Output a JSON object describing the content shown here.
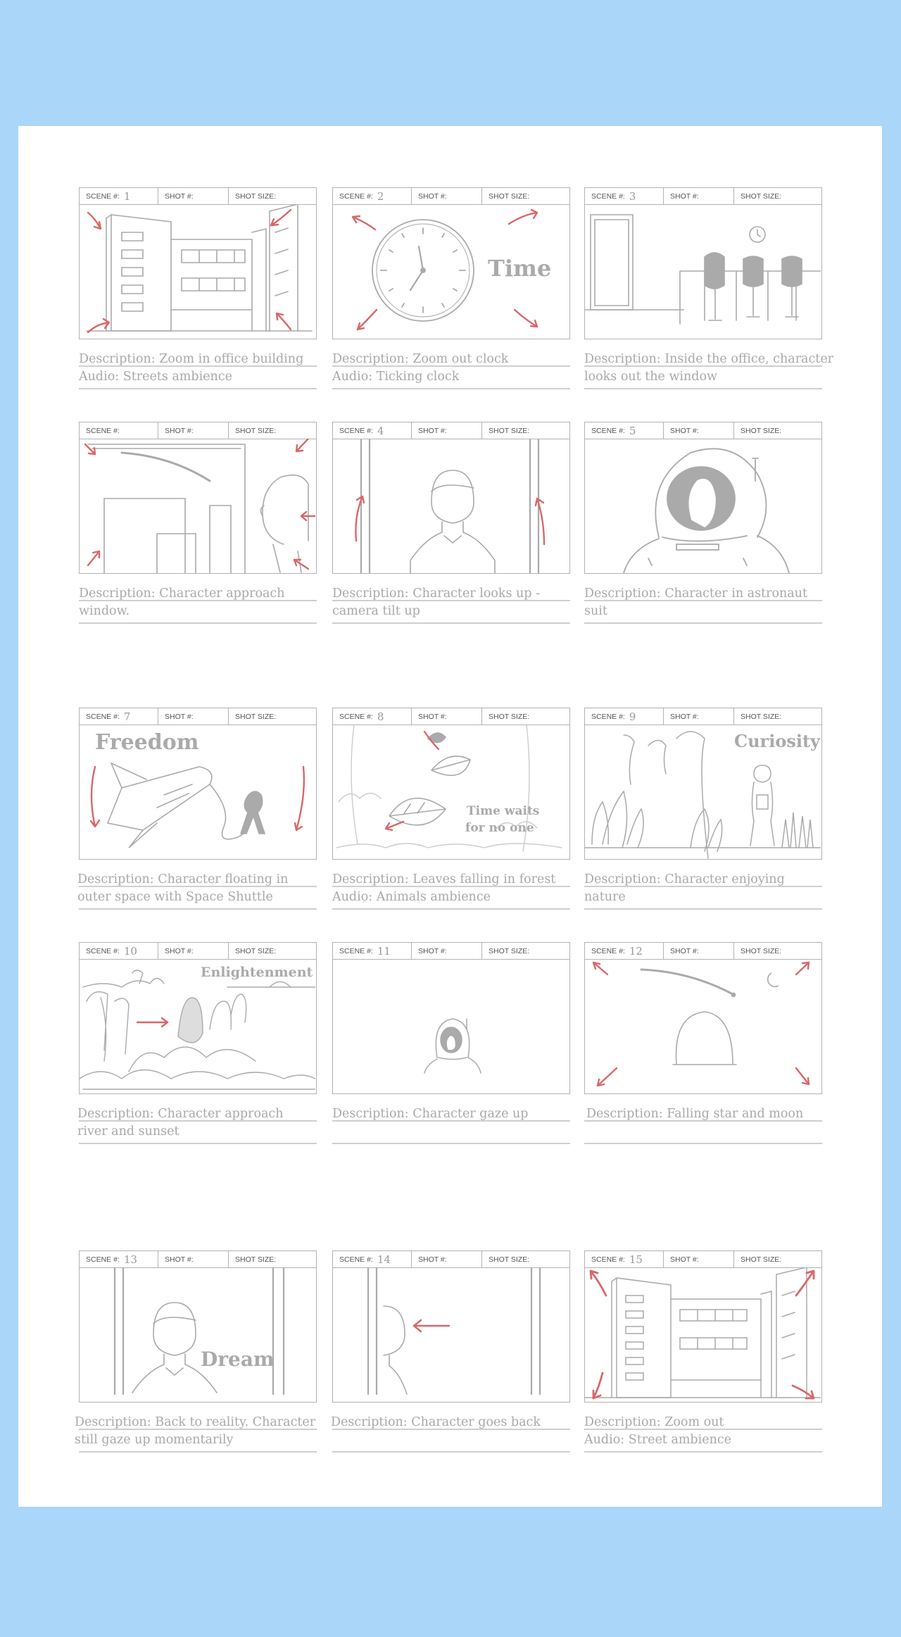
{
  "header_labels": {
    "scene": "SCENE #:",
    "shot": "SHOT #:",
    "shot_size": "SHOT SIZE:"
  },
  "colors": {
    "background": "#a9d6f9",
    "sheet": "#ffffff",
    "sketch": "#aaaaaa",
    "arrow": "#d9676a"
  },
  "panels": [
    {
      "scene_number": "1",
      "description": "Description: Zoom in office building",
      "audio": "Audio: Streets ambience"
    },
    {
      "scene_number": "2",
      "description": "Description: Zoom out clock",
      "audio": "Audio: Ticking clock",
      "caption": "Time"
    },
    {
      "scene_number": "3",
      "description": "Description: Inside the office, character",
      "description_2": "looks out the window"
    },
    {
      "scene_number": "",
      "description": "Description: Character approach",
      "description_2": "window."
    },
    {
      "scene_number": "4",
      "description": "Description: Character looks up -",
      "description_2": "camera tilt up"
    },
    {
      "scene_number": "5",
      "description": "Description: Character in astronaut",
      "description_2": "suit"
    },
    {
      "scene_number": "7",
      "description": "Description: Character floating in",
      "description_2": "outer space with Space Shuttle",
      "caption": "Freedom"
    },
    {
      "scene_number": "8",
      "description": "Description: Leaves falling in forest",
      "audio": "Audio: Animals ambience",
      "caption": "Time waits",
      "caption_2": "for no one"
    },
    {
      "scene_number": "9",
      "description": "Description: Character enjoying",
      "description_2": "nature",
      "caption": "Curiosity"
    },
    {
      "scene_number": "10",
      "description": "Description: Character approach",
      "description_2": "river and sunset",
      "caption": "Enlightenment"
    },
    {
      "scene_number": "11",
      "description": "Description: Character gaze up"
    },
    {
      "scene_number": "12",
      "description": "Description: Falling star and moon"
    },
    {
      "scene_number": "13",
      "description": "Description: Back to reality. Character",
      "description_2": "still gaze up momentarily",
      "caption": "Dream"
    },
    {
      "scene_number": "14",
      "description": "Description: Character goes back"
    },
    {
      "scene_number": "15",
      "description": "Description: Zoom out",
      "audio": "Audio: Street ambience"
    }
  ]
}
